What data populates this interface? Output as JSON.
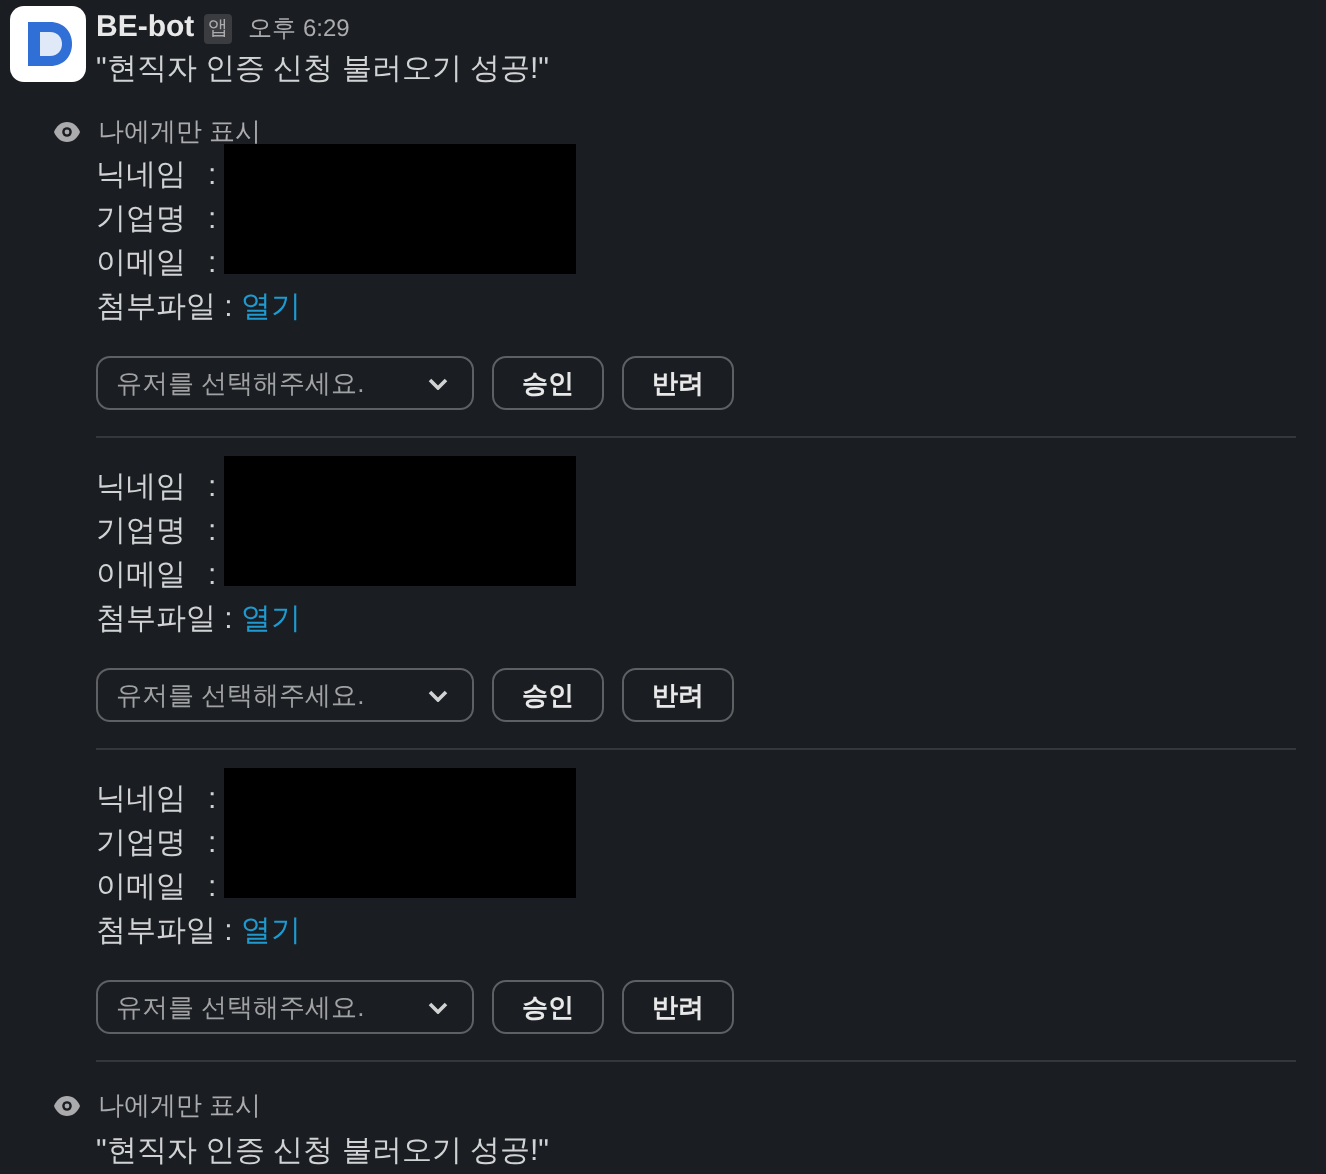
{
  "message": {
    "sender": "BE-bot",
    "badge": "앱",
    "time": "오후 6:29",
    "text": "\"현직자 인증 신청 불러오기 성공!\""
  },
  "visibility_note": "나에게만 표시",
  "requests": [
    {
      "fields": [
        {
          "label": "닉네임",
          "separator": ":"
        },
        {
          "label": "기업명",
          "separator": ":"
        },
        {
          "label": "이메일",
          "separator": ":"
        }
      ],
      "attachment": {
        "label": "첨부파일 :",
        "link": "열기"
      },
      "select": {
        "placeholder": "유저를 선택해주세요."
      },
      "buttons": [
        "승인",
        "반려"
      ]
    },
    {
      "fields": [
        {
          "label": "닉네임",
          "separator": ":"
        },
        {
          "label": "기업명",
          "separator": ":"
        },
        {
          "label": "이메일",
          "separator": ":"
        }
      ],
      "attachment": {
        "label": "첨부파일 :",
        "link": "열기"
      },
      "select": {
        "placeholder": "유저를 선택해주세요."
      },
      "buttons": [
        "승인",
        "반려"
      ]
    },
    {
      "fields": [
        {
          "label": "닉네임",
          "separator": ":"
        },
        {
          "label": "기업명",
          "separator": ":"
        },
        {
          "label": "이메일",
          "separator": ":"
        }
      ],
      "attachment": {
        "label": "첨부파일 :",
        "link": "열기"
      },
      "select": {
        "placeholder": "유저를 선택해주세요."
      },
      "buttons": [
        "승인",
        "반려"
      ]
    }
  ],
  "followup": {
    "visibility_note": "나에게만 표시",
    "text": "\"현직자 인증 신청 불러오기 성공!\""
  }
}
